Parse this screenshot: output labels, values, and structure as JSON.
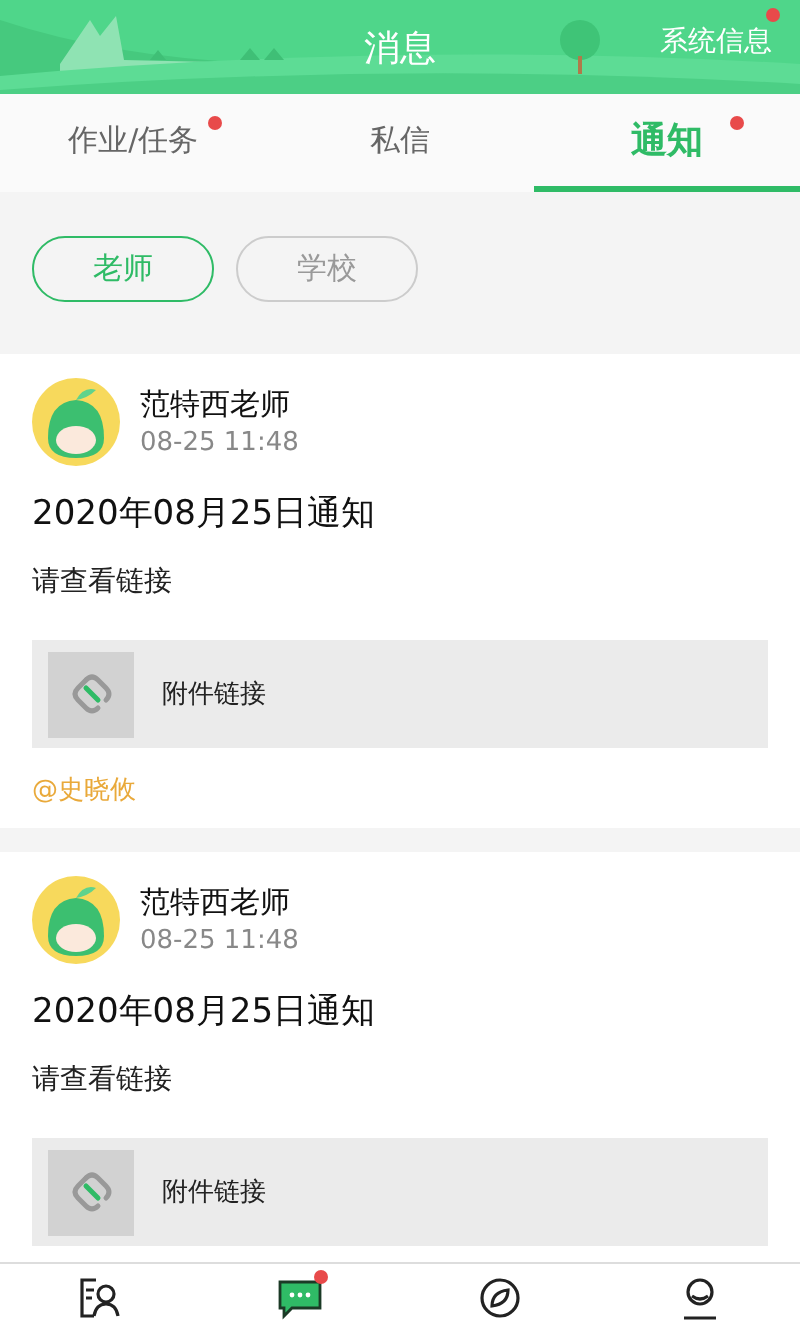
{
  "header": {
    "title": "消息",
    "system_link": {
      "label": "系统信息",
      "unread": true
    }
  },
  "tabs": [
    {
      "label": "作业/任务",
      "selected": false,
      "unread": true
    },
    {
      "label": "私信",
      "selected": false,
      "unread": false
    },
    {
      "label": "通知",
      "selected": true,
      "unread": true
    }
  ],
  "filters": [
    {
      "label": "老师",
      "selected": true
    },
    {
      "label": "学校",
      "selected": false
    }
  ],
  "notices": [
    {
      "sender": "范特西老师",
      "time": "08-25 11:48",
      "title": "2020年08月25日通知",
      "body": "请查看链接",
      "attachment": {
        "label": "附件链接"
      },
      "mention": "@史晓攸"
    },
    {
      "sender": "范特西老师",
      "time": "08-25 11:48",
      "title": "2020年08月25日通知",
      "body": "请查看链接",
      "attachment": {
        "label": "附件链接"
      }
    }
  ],
  "bottom_nav": [
    {
      "kind": "contacts",
      "selected": false,
      "unread": false
    },
    {
      "kind": "chat",
      "selected": true,
      "unread": true
    },
    {
      "kind": "discover",
      "selected": false,
      "unread": false
    },
    {
      "kind": "profile",
      "selected": false,
      "unread": false
    }
  ]
}
